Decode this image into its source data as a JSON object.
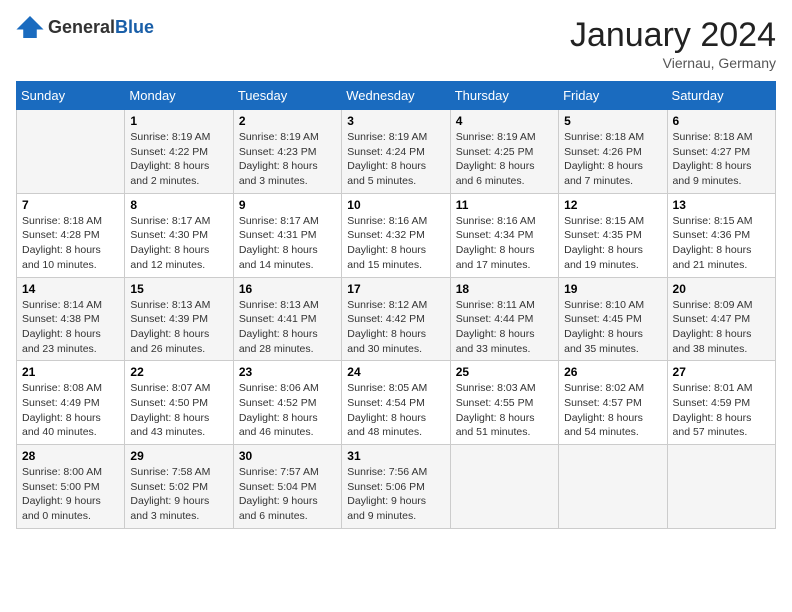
{
  "logo": {
    "general": "General",
    "blue": "Blue"
  },
  "title": "January 2024",
  "subtitle": "Viernau, Germany",
  "days_of_week": [
    "Sunday",
    "Monday",
    "Tuesday",
    "Wednesday",
    "Thursday",
    "Friday",
    "Saturday"
  ],
  "weeks": [
    [
      {
        "day": "",
        "sunrise": "",
        "sunset": "",
        "daylight": ""
      },
      {
        "day": "1",
        "sunrise": "Sunrise: 8:19 AM",
        "sunset": "Sunset: 4:22 PM",
        "daylight": "Daylight: 8 hours and 2 minutes."
      },
      {
        "day": "2",
        "sunrise": "Sunrise: 8:19 AM",
        "sunset": "Sunset: 4:23 PM",
        "daylight": "Daylight: 8 hours and 3 minutes."
      },
      {
        "day": "3",
        "sunrise": "Sunrise: 8:19 AM",
        "sunset": "Sunset: 4:24 PM",
        "daylight": "Daylight: 8 hours and 5 minutes."
      },
      {
        "day": "4",
        "sunrise": "Sunrise: 8:19 AM",
        "sunset": "Sunset: 4:25 PM",
        "daylight": "Daylight: 8 hours and 6 minutes."
      },
      {
        "day": "5",
        "sunrise": "Sunrise: 8:18 AM",
        "sunset": "Sunset: 4:26 PM",
        "daylight": "Daylight: 8 hours and 7 minutes."
      },
      {
        "day": "6",
        "sunrise": "Sunrise: 8:18 AM",
        "sunset": "Sunset: 4:27 PM",
        "daylight": "Daylight: 8 hours and 9 minutes."
      }
    ],
    [
      {
        "day": "7",
        "sunrise": "Sunrise: 8:18 AM",
        "sunset": "Sunset: 4:28 PM",
        "daylight": "Daylight: 8 hours and 10 minutes."
      },
      {
        "day": "8",
        "sunrise": "Sunrise: 8:17 AM",
        "sunset": "Sunset: 4:30 PM",
        "daylight": "Daylight: 8 hours and 12 minutes."
      },
      {
        "day": "9",
        "sunrise": "Sunrise: 8:17 AM",
        "sunset": "Sunset: 4:31 PM",
        "daylight": "Daylight: 8 hours and 14 minutes."
      },
      {
        "day": "10",
        "sunrise": "Sunrise: 8:16 AM",
        "sunset": "Sunset: 4:32 PM",
        "daylight": "Daylight: 8 hours and 15 minutes."
      },
      {
        "day": "11",
        "sunrise": "Sunrise: 8:16 AM",
        "sunset": "Sunset: 4:34 PM",
        "daylight": "Daylight: 8 hours and 17 minutes."
      },
      {
        "day": "12",
        "sunrise": "Sunrise: 8:15 AM",
        "sunset": "Sunset: 4:35 PM",
        "daylight": "Daylight: 8 hours and 19 minutes."
      },
      {
        "day": "13",
        "sunrise": "Sunrise: 8:15 AM",
        "sunset": "Sunset: 4:36 PM",
        "daylight": "Daylight: 8 hours and 21 minutes."
      }
    ],
    [
      {
        "day": "14",
        "sunrise": "Sunrise: 8:14 AM",
        "sunset": "Sunset: 4:38 PM",
        "daylight": "Daylight: 8 hours and 23 minutes."
      },
      {
        "day": "15",
        "sunrise": "Sunrise: 8:13 AM",
        "sunset": "Sunset: 4:39 PM",
        "daylight": "Daylight: 8 hours and 26 minutes."
      },
      {
        "day": "16",
        "sunrise": "Sunrise: 8:13 AM",
        "sunset": "Sunset: 4:41 PM",
        "daylight": "Daylight: 8 hours and 28 minutes."
      },
      {
        "day": "17",
        "sunrise": "Sunrise: 8:12 AM",
        "sunset": "Sunset: 4:42 PM",
        "daylight": "Daylight: 8 hours and 30 minutes."
      },
      {
        "day": "18",
        "sunrise": "Sunrise: 8:11 AM",
        "sunset": "Sunset: 4:44 PM",
        "daylight": "Daylight: 8 hours and 33 minutes."
      },
      {
        "day": "19",
        "sunrise": "Sunrise: 8:10 AM",
        "sunset": "Sunset: 4:45 PM",
        "daylight": "Daylight: 8 hours and 35 minutes."
      },
      {
        "day": "20",
        "sunrise": "Sunrise: 8:09 AM",
        "sunset": "Sunset: 4:47 PM",
        "daylight": "Daylight: 8 hours and 38 minutes."
      }
    ],
    [
      {
        "day": "21",
        "sunrise": "Sunrise: 8:08 AM",
        "sunset": "Sunset: 4:49 PM",
        "daylight": "Daylight: 8 hours and 40 minutes."
      },
      {
        "day": "22",
        "sunrise": "Sunrise: 8:07 AM",
        "sunset": "Sunset: 4:50 PM",
        "daylight": "Daylight: 8 hours and 43 minutes."
      },
      {
        "day": "23",
        "sunrise": "Sunrise: 8:06 AM",
        "sunset": "Sunset: 4:52 PM",
        "daylight": "Daylight: 8 hours and 46 minutes."
      },
      {
        "day": "24",
        "sunrise": "Sunrise: 8:05 AM",
        "sunset": "Sunset: 4:54 PM",
        "daylight": "Daylight: 8 hours and 48 minutes."
      },
      {
        "day": "25",
        "sunrise": "Sunrise: 8:03 AM",
        "sunset": "Sunset: 4:55 PM",
        "daylight": "Daylight: 8 hours and 51 minutes."
      },
      {
        "day": "26",
        "sunrise": "Sunrise: 8:02 AM",
        "sunset": "Sunset: 4:57 PM",
        "daylight": "Daylight: 8 hours and 54 minutes."
      },
      {
        "day": "27",
        "sunrise": "Sunrise: 8:01 AM",
        "sunset": "Sunset: 4:59 PM",
        "daylight": "Daylight: 8 hours and 57 minutes."
      }
    ],
    [
      {
        "day": "28",
        "sunrise": "Sunrise: 8:00 AM",
        "sunset": "Sunset: 5:00 PM",
        "daylight": "Daylight: 9 hours and 0 minutes."
      },
      {
        "day": "29",
        "sunrise": "Sunrise: 7:58 AM",
        "sunset": "Sunset: 5:02 PM",
        "daylight": "Daylight: 9 hours and 3 minutes."
      },
      {
        "day": "30",
        "sunrise": "Sunrise: 7:57 AM",
        "sunset": "Sunset: 5:04 PM",
        "daylight": "Daylight: 9 hours and 6 minutes."
      },
      {
        "day": "31",
        "sunrise": "Sunrise: 7:56 AM",
        "sunset": "Sunset: 5:06 PM",
        "daylight": "Daylight: 9 hours and 9 minutes."
      },
      {
        "day": "",
        "sunrise": "",
        "sunset": "",
        "daylight": ""
      },
      {
        "day": "",
        "sunrise": "",
        "sunset": "",
        "daylight": ""
      },
      {
        "day": "",
        "sunrise": "",
        "sunset": "",
        "daylight": ""
      }
    ]
  ]
}
